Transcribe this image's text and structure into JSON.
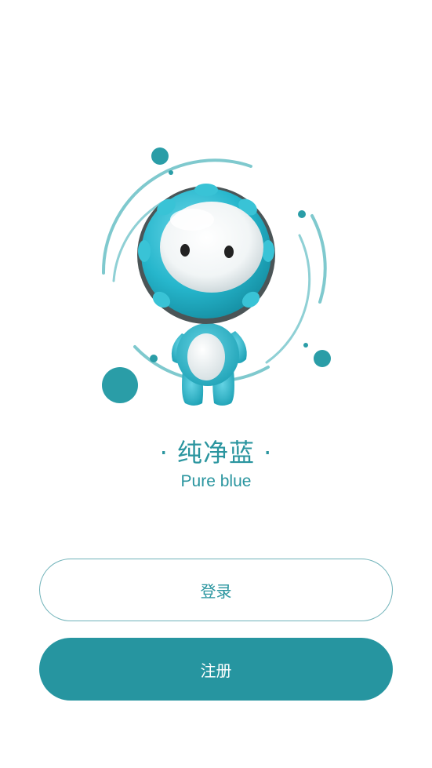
{
  "brand": {
    "title": "· 纯净蓝 ·",
    "subtitle": "Pure blue"
  },
  "actions": {
    "login_label": "登录",
    "register_label": "注册"
  },
  "mascot": {
    "icon": "robot-mascot-icon"
  },
  "colors": {
    "accent": "#2695a0",
    "text_accent": "#2a959f",
    "login_border": "#6fb2b9",
    "background": "#ffffff"
  }
}
